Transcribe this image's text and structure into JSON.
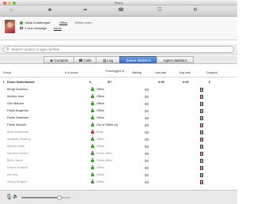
{
  "window": {
    "title": "Telepo",
    "traffic_colors": [
      "#ec5f5a",
      "#f5bd3c",
      "#5fc33d"
    ]
  },
  "toolbar": {
    "icons": [
      "home-icon",
      "contacts-icon",
      "forward-icon",
      "switchboard-icon",
      "dialpad-icon",
      "settings-icon"
    ]
  },
  "profile": {
    "name": "Yalda Zolrahnejad",
    "status": "Office",
    "note_placeholder": "<Enter note>",
    "new_message_text": "1 new message",
    "inbox_link": "Inbox"
  },
  "search": {
    "placeholder": "Search contact or type number"
  },
  "tabs": [
    {
      "label": "Contacts",
      "icon": "contacts-icon",
      "active": false
    },
    {
      "label": "Calls",
      "icon": "phone-icon",
      "active": false
    },
    {
      "label": "Log",
      "icon": "log-icon",
      "active": false
    },
    {
      "label": "Queue statistics",
      "icon": "",
      "active": true
    },
    {
      "label": "Agent statistics",
      "icon": "",
      "active": false
    }
  ],
  "table": {
    "headers": {
      "group": "Group",
      "in_queue": "# in queue",
      "free_logged": "Free/logged in",
      "waiting": "Waiting",
      "last_wait": "Last wait",
      "avg_wait": "Avg wait",
      "dropped": "Dropped"
    },
    "group_row": {
      "name": "Demo Switchboard",
      "in_queue": "0",
      "free_logged": "5/7",
      "last_wait": "0:35",
      "avg_wait": "0:00",
      "dropped": "0"
    },
    "agents": [
      {
        "name": "Bengt Sorenius",
        "status": "Office",
        "color": "#3a9c2a",
        "active": true
      },
      {
        "name": "Monitor User",
        "status": "Office",
        "color": "#3a9c2a",
        "active": true
      },
      {
        "name": "Ola Hilström",
        "status": "Office",
        "color": "#3a9c2a",
        "active": true
      },
      {
        "name": "Patrik Engström",
        "status": "Office",
        "color": "#3a9c2a",
        "active": true
      },
      {
        "name": "Patrik Granholm",
        "status": "Office",
        "color": "#3a9c2a",
        "active": true
      },
      {
        "name": "Patrik Sörsnöt",
        "status": "Out of Office (A)",
        "color": "#3a9c2a",
        "active": true
      },
      {
        "name": "Alice Andersson",
        "status": "Busy",
        "color": "#c8322a",
        "active": false
      },
      {
        "name": "Andreas Söderng",
        "status": "Office",
        "color": "#3a9c2a",
        "active": false
      },
      {
        "name": "Ayreen Kahn",
        "status": "Office",
        "color": "#3a9c2a",
        "active": false
      },
      {
        "name": "Ayreens Demo1",
        "status": "Home office",
        "color": "#3a9c2a",
        "active": false
      },
      {
        "name": "Björn Jasse",
        "status": "Home office",
        "color": "#3a9c2a",
        "active": false
      },
      {
        "name": "Dennis Rukschi",
        "status": "Office",
        "color": "#3a9c2a",
        "active": false
      },
      {
        "name": "efe kbsj",
        "status": "Office",
        "color": "#3a9c2a",
        "active": false
      },
      {
        "name": "Georg Kullgren",
        "status": "Office",
        "color": "#3a9c2a",
        "active": false
      }
    ]
  },
  "volume": {
    "level": 0.78
  }
}
